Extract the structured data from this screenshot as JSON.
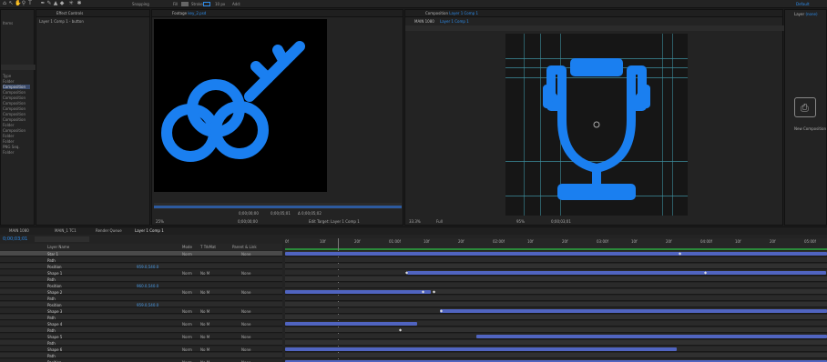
{
  "topbar": {
    "snapping_label": "Snapping",
    "fill_label": "Fill",
    "stroke_label": "Stroke",
    "px_label": "10 px",
    "add_label": "Add:",
    "default_label": "Default",
    "default_value": "Default"
  },
  "project_panel": {
    "header": "Effect Controls",
    "sublabel": "Layer 1 Comp 1 - button",
    "items_label": "Items",
    "type_label": "Type",
    "folder_label": "Folder",
    "items": [
      "Composition",
      "Composition",
      "Composition",
      "Composition",
      "Composition",
      "Composition",
      "Composition",
      "Folder",
      "Composition",
      "Folder",
      "Folder",
      "PNG Seq.",
      "Folder"
    ]
  },
  "footage_panel": {
    "tab": "Footage",
    "tab_file": "key_2.psd",
    "zoom": "25%",
    "timecode": "0;00;00;00",
    "bottom_timecode": "0;00;00;00",
    "duration": "0;00;05;01",
    "delta": "Δ 0;00;05;02",
    "set_target": "Edit Target: Layer 1 Comp 1"
  },
  "comp_panel": {
    "tab": "Composition",
    "tab_file": "Layer 1 Comp 1",
    "breadcrumb_1": "MAIN 1080",
    "breadcrumb_2": "Layer 1 Comp 1",
    "zoom": "33.3%",
    "quality": "Full",
    "timecode": "0;00;03;01",
    "marker": "95%"
  },
  "right_panel": {
    "layers_label": "Layer",
    "layers_value": "(none)",
    "new_comp_label": "New Composition"
  },
  "timeline": {
    "tabs": [
      "MAIN 1080",
      "MAIN_1 TC1",
      "Render Queue",
      "Layer 1 Comp 1"
    ],
    "timecode": "0;00;03;01",
    "search_placeholder": "",
    "col_layer_name": "Layer Name",
    "col_mode": "Mode",
    "col_trkmat": "T TrkMat",
    "col_parent": "Parent & Link",
    "layers": [
      {
        "num": "1",
        "name": "Star 1",
        "mode": "Norm",
        "trk": "",
        "parent": "None",
        "value": "",
        "sel": true
      },
      {
        "num": "",
        "name": "Path",
        "mode": "",
        "trk": "",
        "parent": "",
        "value": "",
        "sel": false
      },
      {
        "num": "",
        "name": "Position",
        "mode": "",
        "trk": "",
        "parent": "",
        "value": "959.0,540.0",
        "sel": false
      },
      {
        "num": "2",
        "name": "Shape 1",
        "mode": "Norm",
        "trk": "No M",
        "parent": "None",
        "value": "",
        "sel": false
      },
      {
        "num": "",
        "name": "Path",
        "mode": "",
        "trk": "",
        "parent": "",
        "value": "",
        "sel": false
      },
      {
        "num": "",
        "name": "Position",
        "mode": "",
        "trk": "",
        "parent": "",
        "value": "960.0,540.0",
        "sel": false
      },
      {
        "num": "3",
        "name": "Shape 2",
        "mode": "Norm",
        "trk": "No M",
        "parent": "None",
        "value": "",
        "sel": false
      },
      {
        "num": "",
        "name": "Path",
        "mode": "",
        "trk": "",
        "parent": "",
        "value": "",
        "sel": false
      },
      {
        "num": "",
        "name": "Position",
        "mode": "",
        "trk": "",
        "parent": "",
        "value": "959.0,540.0",
        "sel": false
      },
      {
        "num": "4",
        "name": "Shape 3",
        "mode": "Norm",
        "trk": "No M",
        "parent": "None",
        "value": "",
        "sel": false
      },
      {
        "num": "",
        "name": "Path",
        "mode": "",
        "trk": "",
        "parent": "",
        "value": "",
        "sel": false
      },
      {
        "num": "5",
        "name": "Shape 4",
        "mode": "Norm",
        "trk": "No M",
        "parent": "None",
        "value": "",
        "sel": false
      },
      {
        "num": "",
        "name": "Path",
        "mode": "",
        "trk": "",
        "parent": "",
        "value": "",
        "sel": false
      },
      {
        "num": "6",
        "name": "Shape 5",
        "mode": "Norm",
        "trk": "No M",
        "parent": "None",
        "value": "",
        "sel": false
      },
      {
        "num": "",
        "name": "Path",
        "mode": "",
        "trk": "",
        "parent": "",
        "value": "",
        "sel": false
      },
      {
        "num": "7",
        "name": "Shape 6",
        "mode": "Norm",
        "trk": "No M",
        "parent": "None",
        "value": "",
        "sel": false
      },
      {
        "num": "",
        "name": "Path",
        "mode": "",
        "trk": "",
        "parent": "",
        "value": "",
        "sel": false
      },
      {
        "num": "8",
        "name": "Position",
        "mode": "Norm",
        "trk": "No M",
        "parent": "None",
        "value": "",
        "sel": false
      }
    ],
    "ruler": [
      "0f",
      "10f",
      "20f",
      "01:00f",
      "10f",
      "20f",
      "02:00f",
      "10f",
      "20f",
      "03:00f",
      "10f",
      "20f",
      "04:00f",
      "10f",
      "20f",
      "05:00f"
    ],
    "accent": "#2d8ceb",
    "bar_color": "#5064c0"
  },
  "colors": {
    "icon_blue": "#1a7ff0",
    "bg": "#1d1d1d",
    "panel": "#232323"
  }
}
